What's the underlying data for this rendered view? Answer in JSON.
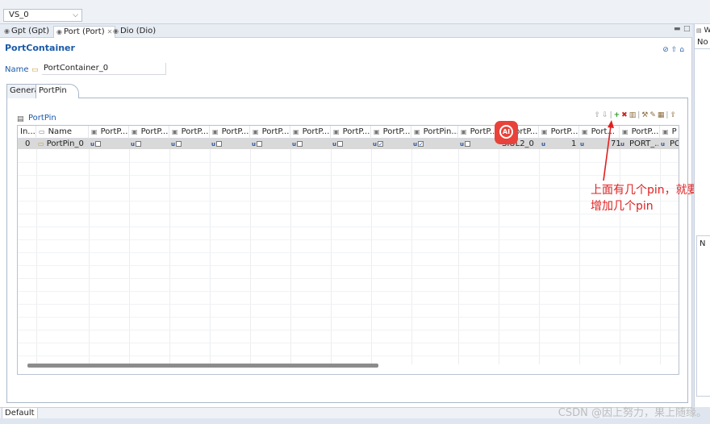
{
  "topbar": {
    "select_value": "VS_0"
  },
  "tabs": [
    {
      "label": "Gpt (Gpt)"
    },
    {
      "label": "Port (Port)"
    },
    {
      "label": "Dio (Dio)"
    }
  ],
  "editor": {
    "title": "PortContainer",
    "name_label": "Name",
    "name_value": "PortContainer_0",
    "inner_tabs": [
      "General",
      "PortPin"
    ],
    "section_title": "PortPin"
  },
  "table": {
    "columns": [
      "In...",
      "Name",
      "PortP...",
      "PortP...",
      "PortP...",
      "PortP...",
      "PortP...",
      "PortP...",
      "PortP...",
      "PortP...",
      "PortPin...",
      "PortP...",
      "PortP...",
      "PortP...",
      "Port...",
      "PortP...",
      "P"
    ],
    "row": {
      "index": "0",
      "name": "PortPin_0",
      "cell_mode": "SIUL2_0",
      "cell_a": "1",
      "cell_b": "71",
      "cell_c": "PORT_...",
      "cell_d": "PC"
    }
  },
  "annotation": {
    "line1": "上面有几个pin，就要",
    "line2": "增加几个pin"
  },
  "status": {
    "default_tab": "Default"
  },
  "watermark": "CSDN @因上努力，果上随缘。",
  "right_pane": {
    "tab": "W",
    "no_label": "No",
    "n_label": "N"
  }
}
